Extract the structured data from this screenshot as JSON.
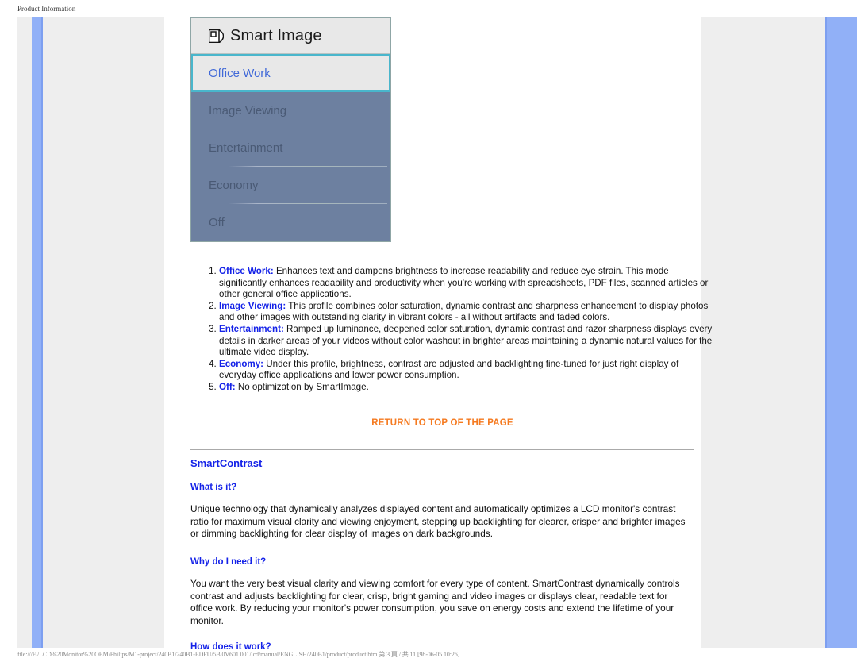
{
  "print_header": {
    "title": "Product Information"
  },
  "print_footer": {
    "path": "file:///E|/LCD%20Monitor%20OEM/Philips/M1-project/240B1/240B1-EDFU/5B.0V601.001/lcd/manual/ENGLISH/240B1/product/product.htm",
    "page_info": "第 3 頁 / 共 11",
    "timestamp": "[98-06-05 10:26]"
  },
  "osd": {
    "icon_name": "smart-image-icon",
    "title": "Smart Image",
    "items": [
      {
        "label": "Office Work",
        "selected": true
      },
      {
        "label": "Image Viewing",
        "selected": false
      },
      {
        "label": "Entertainment",
        "selected": false
      },
      {
        "label": "Economy",
        "selected": false
      },
      {
        "label": "Off",
        "selected": false
      }
    ]
  },
  "feature_list": [
    {
      "lead": "Office Work:",
      "body": " Enhances text and dampens brightness to increase readability and reduce eye strain. This mode significantly enhances readability and productivity when you're working with spreadsheets, PDF files, scanned articles or other general office applications."
    },
    {
      "lead": "Image Viewing:",
      "body": " This profile combines color saturation, dynamic contrast and sharpness enhancement to display photos and other images with outstanding clarity in vibrant colors - all without artifacts and faded colors."
    },
    {
      "lead": "Entertainment:",
      "body": " Ramped up luminance, deepened color saturation, dynamic contrast and razor sharpness displays every details in darker areas of your videos without color washout in brighter areas maintaining a dynamic natural values for the ultimate video display."
    },
    {
      "lead": "Economy:",
      "body": " Under this profile, brightness, contrast are adjusted and backlighting fine-tuned for just right display of everyday office applications and lower power consumption."
    },
    {
      "lead": "Off:",
      "body": " No optimization by SmartImage."
    }
  ],
  "return_link": "RETURN TO TOP OF THE PAGE",
  "smartcontrast": {
    "heading": "SmartContrast",
    "q1": "What is it?",
    "a1": "Unique technology that dynamically analyzes displayed content and automatically optimizes a LCD monitor's contrast ratio for maximum visual clarity and viewing enjoyment, stepping up backlighting for clearer, crisper and brighter images or dimming backlighting for clear display of images on dark backgrounds.",
    "q2": "Why do I need it?",
    "a2": "You want the very best visual clarity and viewing comfort for every type of content. SmartContrast dynamically controls contrast and adjusts backlighting for clear, crisp, bright gaming and video images or displays clear, readable text for office work. By reducing your monitor's power consumption, you save on energy costs and extend the lifetime of your monitor.",
    "q3": "How does it work?"
  },
  "colors": {
    "link_blue": "#1422e8",
    "return_orange": "#f57a20",
    "osd_panel": "#6d80a0",
    "osd_highlight_border": "#49b6cc",
    "rail_blue": "#91b0f7"
  }
}
